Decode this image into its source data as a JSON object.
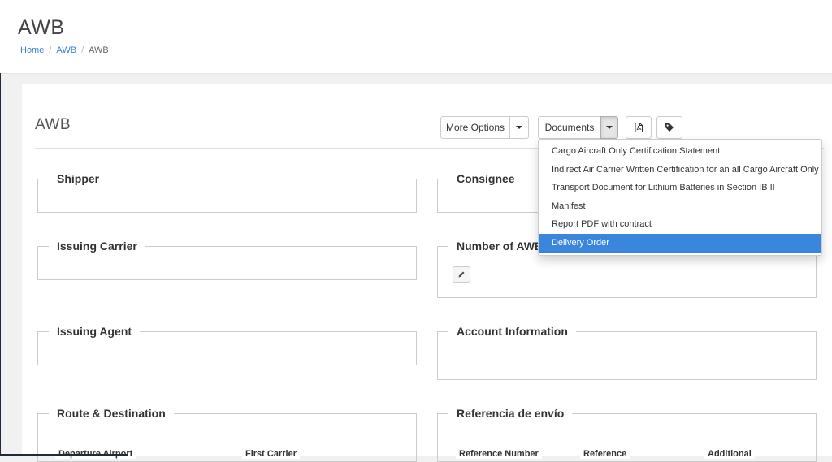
{
  "header": {
    "title": "AWB",
    "breadcrumb": [
      "Home",
      "AWB",
      "AWB"
    ]
  },
  "panel": {
    "title": "AWB"
  },
  "toolbar": {
    "more_options_label": "More Options",
    "documents_label": "Documents",
    "pdf_icon": "file-pdf-icon",
    "tag_icon": "tag-icon"
  },
  "documents_menu": {
    "items": [
      "Cargo Aircraft Only Certification Statement",
      "Indirect Air Carrier Written Certification for an all Cargo Aircraft Only",
      "Transport Document for Lithium Batteries in Section IB II",
      "Manifest",
      "Report PDF with contract",
      "Delivery Order"
    ],
    "selected": "Delivery Order"
  },
  "sections": {
    "shipper": "Shipper",
    "consignee": "Consignee",
    "issuing_carrier": "Issuing Carrier",
    "number_of_awb": "Number of AWB",
    "issuing_agent": "Issuing Agent",
    "account_information": "Account Information",
    "route_destination": "Route & Destination",
    "referencia_envio": "Referencia de envío"
  },
  "route_fields": {
    "departure_airport": "Departure Airport",
    "first_carrier": "First Carrier"
  },
  "reference_fields": {
    "reference_number": "Reference Number",
    "reference": "Reference",
    "additional": "Additional"
  },
  "colors": {
    "link": "#3a7fd5",
    "active": "#3b86dd"
  }
}
